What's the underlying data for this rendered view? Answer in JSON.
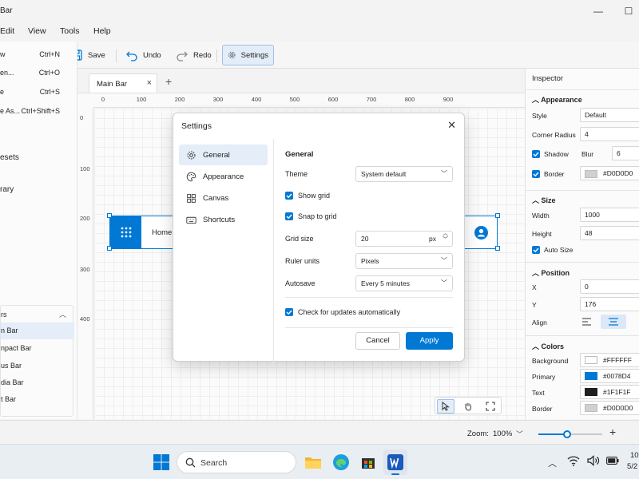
{
  "window": {
    "title": "Bar",
    "minimize_glyph": "—",
    "maximize_glyph": "☐"
  },
  "menubar": {
    "items": [
      "Edit",
      "View",
      "Tools",
      "Help"
    ]
  },
  "toolbar": {
    "save": "Save",
    "undo": "Undo",
    "redo": "Redo",
    "settings": "Settings"
  },
  "file_menu": [
    {
      "label": "w",
      "shortcut": "Ctrl+N"
    },
    {
      "label": "en...",
      "shortcut": "Ctrl+O"
    },
    {
      "label": "e",
      "shortcut": "Ctrl+S"
    },
    {
      "label": "e As...",
      "shortcut": "Ctrl+Shift+S"
    }
  ],
  "sidebar": {
    "presets": "esets",
    "library": "rary"
  },
  "layers": {
    "header": "rs",
    "items": [
      "n Bar",
      "npact Bar",
      "us Bar",
      "dia Bar",
      "t Bar"
    ]
  },
  "tab": {
    "label": "Main Bar"
  },
  "ruler": {
    "top": [
      "0",
      "100",
      "200",
      "300",
      "400",
      "500",
      "600",
      "700",
      "800",
      "900"
    ],
    "left": [
      "0",
      "100",
      "200",
      "300",
      "400"
    ]
  },
  "app_bar_preview": {
    "home": "Home"
  },
  "settings": {
    "title": "Settings",
    "nav": [
      "General",
      "Appearance",
      "Canvas",
      "Shortcuts"
    ],
    "section": "General",
    "theme_label": "Theme",
    "theme_value": "System default",
    "show_grid": "Show grid",
    "snap_grid": "Snap to grid",
    "grid_size_label": "Grid size",
    "grid_size_value": "20",
    "grid_size_unit": "px",
    "ruler_units_label": "Ruler units",
    "ruler_units_value": "Pixels",
    "autosave_label": "Autosave",
    "autosave_value": "Every 5 minutes",
    "updates": "Check for updates automatically",
    "cancel": "Cancel",
    "apply": "Apply"
  },
  "inspector": {
    "title": "Inspector",
    "appearance": "Appearance",
    "style_label": "Style",
    "style_value": "Default",
    "corner_label": "Corner Radius",
    "corner_value": "4",
    "shadow_label": "Shadow",
    "blur_label": "Blur",
    "blur_value": "6",
    "border_label": "Border",
    "border_value": "#D0D0D0",
    "size": "Size",
    "width_label": "Width",
    "width_value": "1000",
    "height_label": "Height",
    "height_value": "48",
    "auto_size": "Auto Size",
    "position": "Position",
    "x_label": "X",
    "x_value": "0",
    "y_label": "Y",
    "y_value": "176",
    "align_label": "Align",
    "colors": "Colors",
    "bg_label": "Background",
    "bg_value": "#FFFFFF",
    "primary_label": "Primary",
    "primary_value": "#0078D4",
    "text_label": "Text",
    "text_value": "#1F1F1F",
    "border2_label": "Border",
    "border2_value": "#D0D0D0"
  },
  "status": {
    "zoom_label": "Zoom:",
    "zoom_value": "100%",
    "zoom_level": 0.45
  },
  "taskbar": {
    "search": "Search",
    "time": "10:",
    "date": "5/2"
  },
  "colors": {
    "accent": "#0078d4",
    "text": "#1f1f1f",
    "border": "#d0d0d0",
    "background": "#ffffff"
  }
}
